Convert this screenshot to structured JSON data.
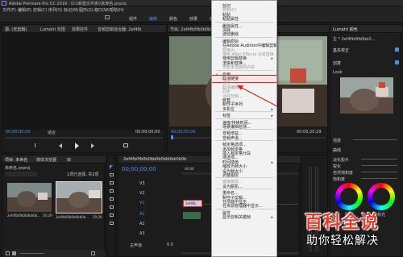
{
  "app": {
    "title": "Adobe Premiere Pro CC 2018 - D:\\\\新建文件夹\\\\未命名.prproj",
    "menubar": [
      "文件(F)",
      "编辑(E)",
      "剪辑(C)",
      "序列(S)",
      "标记(M)",
      "图形(G)",
      "窗口(W)",
      "帮助(H)"
    ],
    "workspace_tabs": [
      "组件",
      "编辑",
      "颜色",
      "效果",
      "音频"
    ]
  },
  "source_panel": {
    "tabs": [
      "源: (无剪辑)",
      "Lumetri 范围",
      "效果控件",
      "音频剪辑混合器: 2ef4fb"
    ],
    "timecode_left": "00;00;00;00",
    "timecode_right": "00;00;00;00",
    "fit": "适合"
  },
  "program_panel": {
    "title": "节目: 2ef4fb0fb0b0bb0b",
    "timecode_left": "00;00;00;00",
    "timecode_right": "00;00;20;29",
    "fit": "完整"
  },
  "lumetri": {
    "title": "Lumetri 颜色",
    "clip": "主 * 2ef4fb0fb0bb0...",
    "section_basic": "基本校正",
    "section_creative": "创意",
    "look": "Look",
    "sliders": [
      "强度",
      "淡化胶片",
      "锐化",
      "自然饱和度",
      "饱和度"
    ],
    "section_curves": "曲线",
    "wheels_title": "色轮和匹配",
    "wheel_labels": [
      "阴影",
      "高光"
    ]
  },
  "project_panel": {
    "tabs": [
      "项目: 未命名",
      "媒体浏览器",
      "库"
    ],
    "subtitle": "未命名.prproj",
    "count": "1项已选择, 共2项",
    "clips": [
      {
        "name": "2ef4fb0fb0b0bb0b...",
        "duration": "20;29"
      },
      {
        "name": "2ef4fb0fb0b0bb0b...",
        "duration": "20;29"
      }
    ]
  },
  "timeline": {
    "title": "2ef4fb0fb0b0bb0b0bb0bb0b0b",
    "timecode": "00;00;00;00",
    "ruler": [
      "00;00",
      "00;00;05;00"
    ],
    "tracks": [
      "V3",
      "V2",
      "V1",
      "A1",
      "A2",
      "A3"
    ],
    "master": "主声道",
    "master_val": "0.0",
    "clip_label": "2ef4fb"
  },
  "context_menu": {
    "items": [
      {
        "label": "剪切",
        "disabled": false
      },
      {
        "label": "复制(C)",
        "disabled": true
      },
      {
        "label": "粘贴",
        "disabled": false
      },
      {
        "label": "粘贴属性",
        "disabled": false
      },
      {
        "sep": true
      },
      {
        "label": "删除属性...",
        "disabled": false
      },
      {
        "label": "清除",
        "disabled": false
      },
      {
        "label": "波纹删除",
        "disabled": false
      },
      {
        "sep": true
      },
      {
        "label": "编辑原始",
        "disabled": false
      },
      {
        "label": "在Adobe Audition中编辑剪辑",
        "disabled": false
      },
      {
        "label": "替换为...",
        "disabled": true
      },
      {
        "label": "使用 After Effects 合成替换",
        "disabled": true
      },
      {
        "label": "使用剪辑替换",
        "disabled": false,
        "submenu": true
      },
      {
        "label": "渲染和替换...",
        "disabled": false
      },
      {
        "label": "恢复未渲染的内容",
        "disabled": true
      },
      {
        "sep": true
      },
      {
        "label": "启用",
        "disabled": false,
        "checked": true
      },
      {
        "label": "取消链接",
        "disabled": false,
        "highlight": true
      },
      {
        "label": "编组",
        "disabled": true
      },
      {
        "label": "取消编组",
        "disabled": true
      },
      {
        "label": "同步",
        "disabled": true
      },
      {
        "label": "合并剪辑...",
        "disabled": true
      },
      {
        "label": "嵌套...",
        "disabled": false
      },
      {
        "label": "制作子序列",
        "disabled": false
      },
      {
        "label": "多机位",
        "disabled": false,
        "submenu": true
      },
      {
        "sep": true
      },
      {
        "label": "标签",
        "disabled": false,
        "submenu": true
      },
      {
        "sep": true
      },
      {
        "label": "速度/持续时间...",
        "disabled": false
      },
      {
        "label": "场景编辑检测...",
        "disabled": false
      },
      {
        "sep": true
      },
      {
        "label": "音频增益...",
        "disabled": false
      },
      {
        "label": "音频声道...",
        "disabled": false
      },
      {
        "sep": true
      },
      {
        "label": "帧定格选项...",
        "disabled": false
      },
      {
        "label": "添加帧定格",
        "disabled": false
      },
      {
        "label": "插入帧定格分段",
        "disabled": false
      },
      {
        "label": "场选项...",
        "disabled": false
      },
      {
        "label": "时间插值",
        "disabled": false,
        "submenu": true
      },
      {
        "label": "缩放为帧大小",
        "disabled": false
      },
      {
        "label": "设为帧大小",
        "disabled": false
      },
      {
        "label": "调整图层",
        "disabled": false
      },
      {
        "sep": true
      },
      {
        "label": "链接媒体...",
        "disabled": true
      },
      {
        "label": "设为脱机...",
        "disabled": false
      },
      {
        "sep": true
      },
      {
        "label": "重命名...",
        "disabled": false
      },
      {
        "label": "制作子剪辑...",
        "disabled": false
      },
      {
        "label": "在项目中显示",
        "disabled": false
      },
      {
        "label": "在资源管理器中显示...",
        "disabled": false
      },
      {
        "sep": true
      },
      {
        "label": "属性",
        "disabled": false
      },
      {
        "label": "显示剪辑关键帧",
        "disabled": false,
        "submenu": true
      }
    ]
  },
  "watermark": {
    "title": "百科全说",
    "subtitle": "助你轻松解决",
    "accent": "#e63b2e"
  },
  "colors": {
    "highlight_box": "#e0261f",
    "menu_bg": "#f2f2f2",
    "selected_blue": "#2a74c8"
  }
}
